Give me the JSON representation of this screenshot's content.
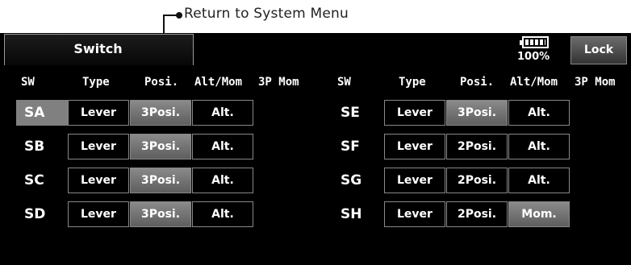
{
  "annotation": {
    "text": "Return to System Menu"
  },
  "header": {
    "title": "Switch",
    "battery": "100%",
    "lock_label": "Lock"
  },
  "columns": {
    "sw": "SW",
    "type": "Type",
    "posi": "Posi.",
    "altmom": "Alt/Mom",
    "mom3p": "3P Mom"
  },
  "left_rows": [
    {
      "sw": "SA",
      "type": "Lever",
      "posi": "3Posi.",
      "mode": "Alt."
    },
    {
      "sw": "SB",
      "type": "Lever",
      "posi": "3Posi.",
      "mode": "Alt."
    },
    {
      "sw": "SC",
      "type": "Lever",
      "posi": "3Posi.",
      "mode": "Alt."
    },
    {
      "sw": "SD",
      "type": "Lever",
      "posi": "3Posi.",
      "mode": "Alt."
    }
  ],
  "right_rows": [
    {
      "sw": "SE",
      "type": "Lever",
      "posi": "3Posi.",
      "mode": "Alt."
    },
    {
      "sw": "SF",
      "type": "Lever",
      "posi": "2Posi.",
      "mode": "Alt."
    },
    {
      "sw": "SG",
      "type": "Lever",
      "posi": "2Posi.",
      "mode": "Alt."
    },
    {
      "sw": "SH",
      "type": "Lever",
      "posi": "2Posi.",
      "mode": "Mom."
    }
  ],
  "colors": {
    "screen_bg": "#000000",
    "selected_bg": "#808080",
    "highlight": "#707070",
    "text": "#ffffff"
  },
  "icons": {
    "battery": "battery-icon"
  }
}
